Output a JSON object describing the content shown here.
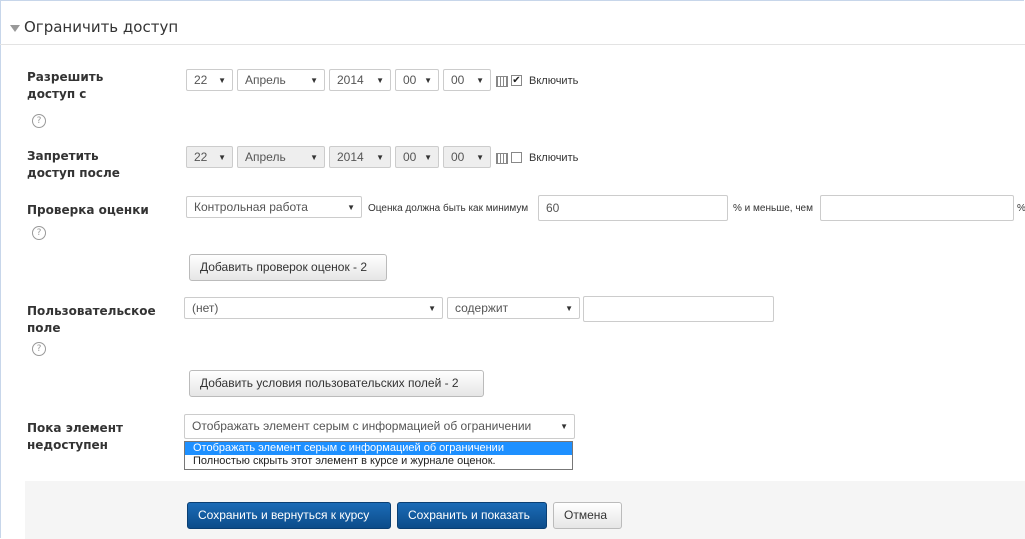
{
  "section": {
    "title": "Ограничить доступ"
  },
  "access_from": {
    "label": "Разрешить доступ с",
    "day": "22",
    "month": "Апрель",
    "year": "2014",
    "hour": "00",
    "minute": "00",
    "enabled": "✔",
    "enable_label": "Включить"
  },
  "access_until": {
    "label": "Запретить доступ после",
    "day": "22",
    "month": "Апрель",
    "year": "2014",
    "hour": "00",
    "minute": "00",
    "enable_label": "Включить"
  },
  "grade": {
    "label": "Проверка оценки",
    "item": "Контрольная работа",
    "min_label": "Оценка должна быть как минимум",
    "min_value": "60",
    "max_label": "% и меньше, чем",
    "max_value": "",
    "percent": "%",
    "add_button": "Добавить проверок оценок - 2"
  },
  "profile": {
    "label": "Пользовательское поле",
    "field": "(нет)",
    "operator": "содержит",
    "value": "",
    "add_button": "Добавить условия пользовательских полей - 2"
  },
  "unavailable": {
    "label": "Пока элемент недоступен",
    "selected": "Отображать элемент серым с информацией об ограничении",
    "options": [
      "Отображать элемент серым с информацией об ограничении",
      "Полностью скрыть этот элемент в курсе и журнале оценок."
    ]
  },
  "footer": {
    "save_return": "Сохранить и вернуться к курсу",
    "save_show": "Сохранить и показать",
    "cancel": "Отмена"
  },
  "icons": {
    "help": "?",
    "arrow": "▼"
  },
  "colors": {
    "primary": "#0f5a9e",
    "highlight": "#1e90ff"
  }
}
